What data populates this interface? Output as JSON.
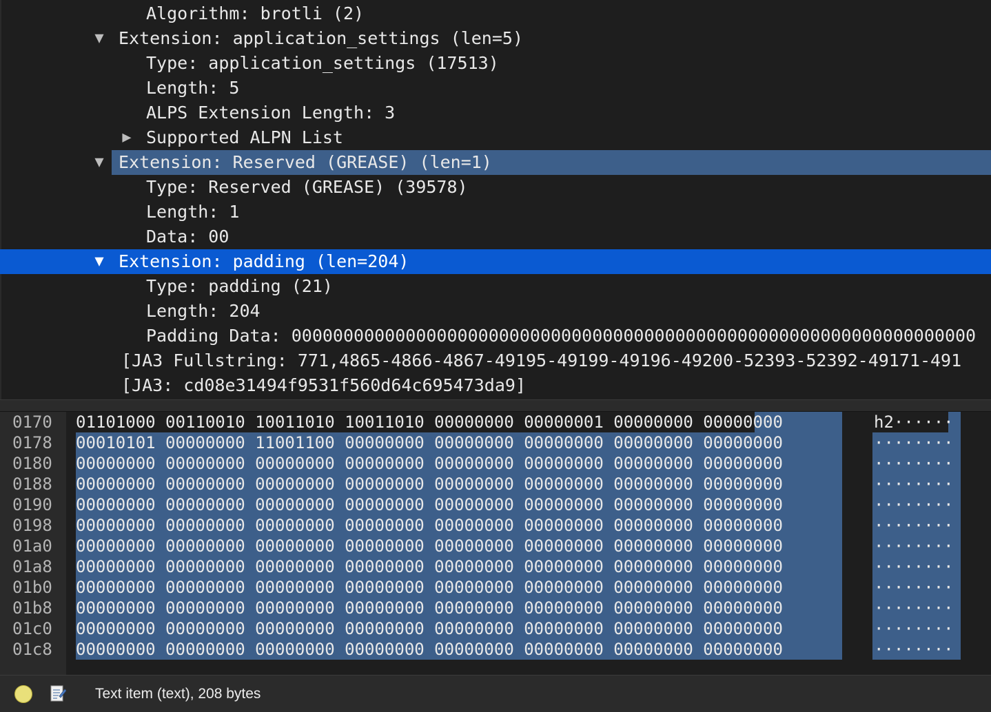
{
  "tree": {
    "rows": [
      {
        "text": "Algorithm: brotli (2)",
        "indent": 2,
        "arrow": "",
        "state": "normal"
      },
      {
        "text": "Extension: application_settings (len=5)",
        "indent": 1,
        "arrow": "▼",
        "state": "normal"
      },
      {
        "text": "Type: application_settings (17513)",
        "indent": 2,
        "arrow": "",
        "state": "normal"
      },
      {
        "text": "Length: 5",
        "indent": 2,
        "arrow": "",
        "state": "normal"
      },
      {
        "text": "ALPS Extension Length: 3",
        "indent": 2,
        "arrow": "",
        "state": "normal"
      },
      {
        "text": "Supported ALPN List",
        "indent": 2,
        "arrow": "▶",
        "state": "normal"
      },
      {
        "text": "Extension: Reserved (GREASE) (len=1)",
        "indent": 1,
        "arrow": "▼",
        "state": "related"
      },
      {
        "text": "Type: Reserved (GREASE) (39578)",
        "indent": 2,
        "arrow": "",
        "state": "normal"
      },
      {
        "text": "Length: 1",
        "indent": 2,
        "arrow": "",
        "state": "normal"
      },
      {
        "text": "Data: 00",
        "indent": 2,
        "arrow": "",
        "state": "normal"
      },
      {
        "text": "Extension: padding (len=204)",
        "indent": 1,
        "arrow": "▼",
        "state": "selected"
      },
      {
        "text": "Type: padding (21)",
        "indent": 2,
        "arrow": "",
        "state": "normal"
      },
      {
        "text": "Length: 204",
        "indent": 2,
        "arrow": "",
        "state": "normal"
      },
      {
        "text": "Padding Data: 000000000000000000000000000000000000000000000000000000000000000000",
        "indent": 2,
        "arrow": "",
        "state": "normal"
      },
      {
        "text": "[JA3 Fullstring: 771,4865-4866-4867-49195-49199-49196-49200-52393-52392-49171-491",
        "indent": 0,
        "arrow": "",
        "state": "normal"
      },
      {
        "text": "[JA3: cd08e31494f9531f560d64c695473da9]",
        "indent": 0,
        "arrow": "",
        "state": "normal"
      }
    ]
  },
  "bytes": {
    "rows": [
      {
        "offset": "0170",
        "bin": "01101000 00110010 10011010 10011010 00000000 00000001 00000000 00000000",
        "ascii": "h2······"
      },
      {
        "offset": "0178",
        "bin": "00010101 00000000 11001100 00000000 00000000 00000000 00000000 00000000",
        "ascii": "········"
      },
      {
        "offset": "0180",
        "bin": "00000000 00000000 00000000 00000000 00000000 00000000 00000000 00000000",
        "ascii": "········"
      },
      {
        "offset": "0188",
        "bin": "00000000 00000000 00000000 00000000 00000000 00000000 00000000 00000000",
        "ascii": "········"
      },
      {
        "offset": "0190",
        "bin": "00000000 00000000 00000000 00000000 00000000 00000000 00000000 00000000",
        "ascii": "········"
      },
      {
        "offset": "0198",
        "bin": "00000000 00000000 00000000 00000000 00000000 00000000 00000000 00000000",
        "ascii": "········"
      },
      {
        "offset": "01a0",
        "bin": "00000000 00000000 00000000 00000000 00000000 00000000 00000000 00000000",
        "ascii": "········"
      },
      {
        "offset": "01a8",
        "bin": "00000000 00000000 00000000 00000000 00000000 00000000 00000000 00000000",
        "ascii": "········"
      },
      {
        "offset": "01b0",
        "bin": "00000000 00000000 00000000 00000000 00000000 00000000 00000000 00000000",
        "ascii": "········"
      },
      {
        "offset": "01b8",
        "bin": "00000000 00000000 00000000 00000000 00000000 00000000 00000000 00000000",
        "ascii": "········"
      },
      {
        "offset": "01c0",
        "bin": "00000000 00000000 00000000 00000000 00000000 00000000 00000000 00000000",
        "ascii": "········"
      },
      {
        "offset": "01c8",
        "bin": "00000000 00000000 00000000 00000000 00000000 00000000 00000000 00000000",
        "ascii": "········"
      }
    ]
  },
  "status": {
    "text": "Text item (text), 208 bytes",
    "dot_color": "#e9e07a"
  },
  "colors": {
    "selected_row": "#0a5ad2",
    "related_highlight": "#3d5f8a",
    "background": "#1e1e1e"
  }
}
